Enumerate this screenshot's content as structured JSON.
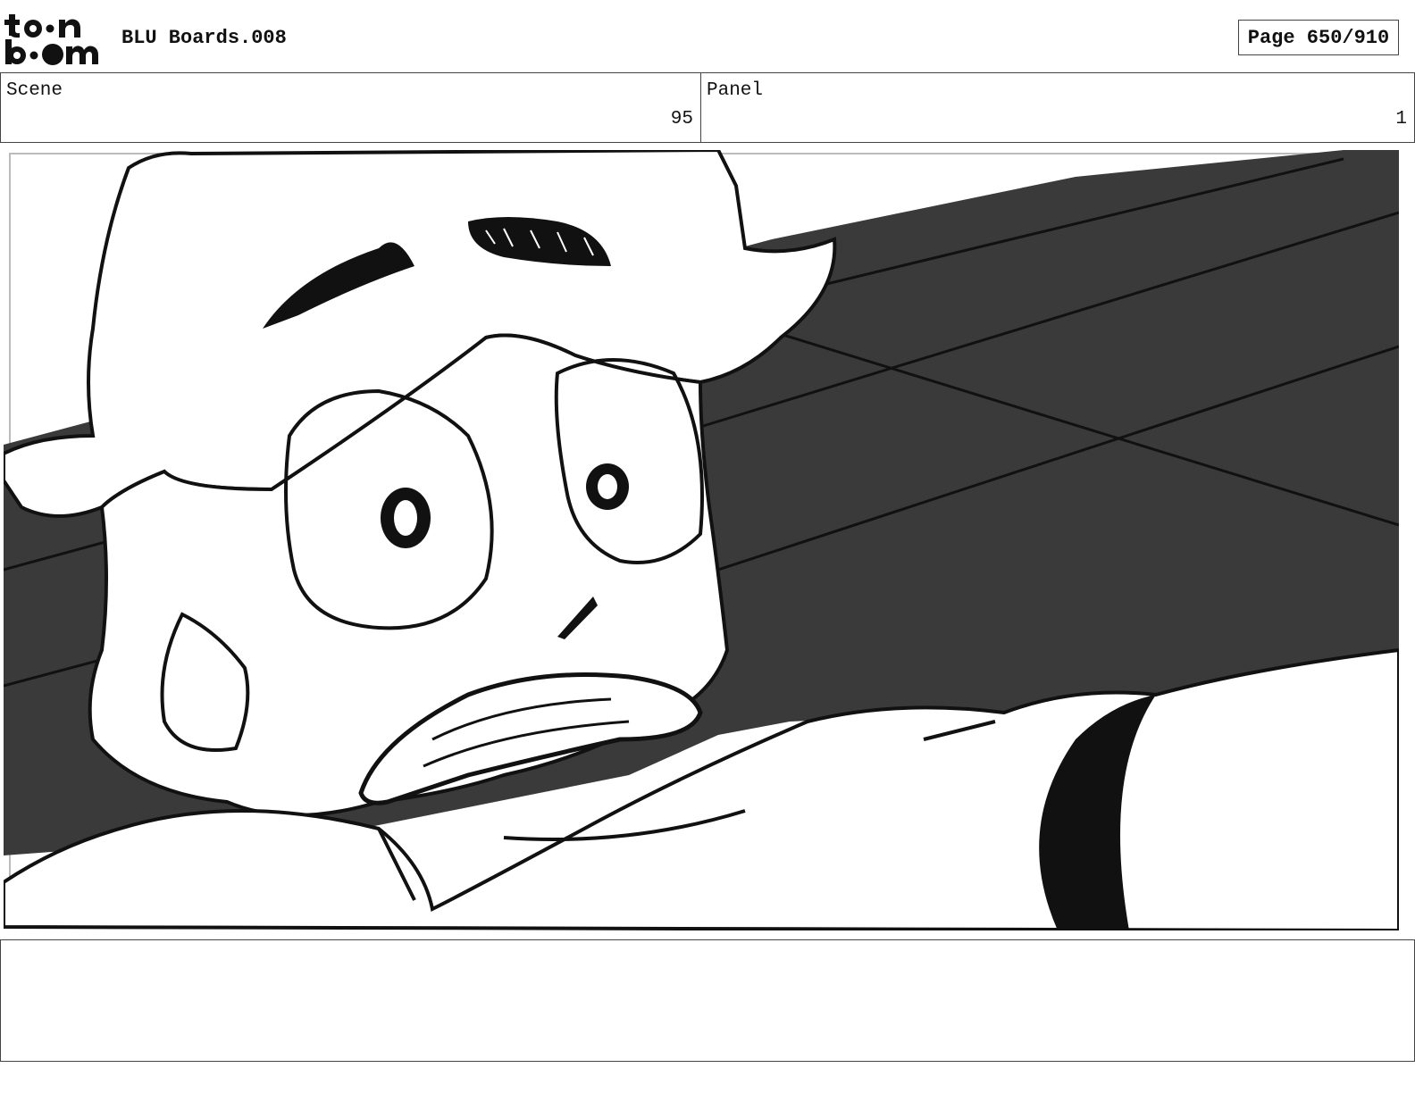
{
  "header": {
    "logo_text_top": "toon",
    "logo_text_bottom": "boom",
    "title": "BLU Boards.008",
    "page": "Page 650/910"
  },
  "info": {
    "scene_label": "Scene",
    "scene_value": "95",
    "panel_label": "Panel",
    "panel_value": "1"
  },
  "notes": {
    "text": ""
  }
}
